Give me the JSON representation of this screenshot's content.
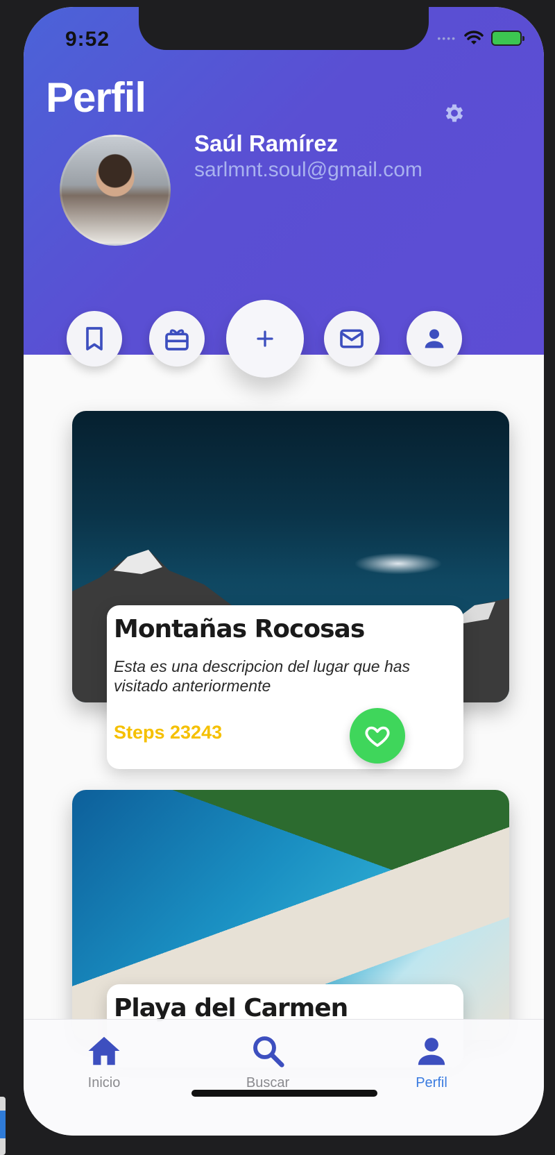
{
  "status_bar": {
    "time": "9:52"
  },
  "header": {
    "title": "Perfil",
    "user": {
      "name": "Saúl Ramírez",
      "email": "sarlmnt.soul@gmail.com"
    }
  },
  "actions": [
    {
      "icon": "bookmark-icon"
    },
    {
      "icon": "gift-card-icon"
    },
    {
      "icon": "plus-icon"
    },
    {
      "icon": "mail-icon"
    },
    {
      "icon": "person-icon"
    }
  ],
  "places": [
    {
      "title": "Montañas Rocosas",
      "description": "Esta es una descripcion del lugar que has visitado anteriormente",
      "steps": "Steps 23243"
    },
    {
      "title": "Playa del Carmen"
    }
  ],
  "tabbar": {
    "items": [
      {
        "label": "Inicio",
        "icon": "home-icon"
      },
      {
        "label": "Buscar",
        "icon": "search-icon"
      },
      {
        "label": "Perfil",
        "icon": "person-icon",
        "active": true
      }
    ]
  },
  "colors": {
    "header_gradient_start": "#4b63d8",
    "header_gradient_end": "#5d4dd4",
    "icon_indigo": "#3d4fbf",
    "steps_yellow": "#f5c000",
    "favorite_green": "#3fd65b",
    "tab_active": "#3a7be0"
  }
}
